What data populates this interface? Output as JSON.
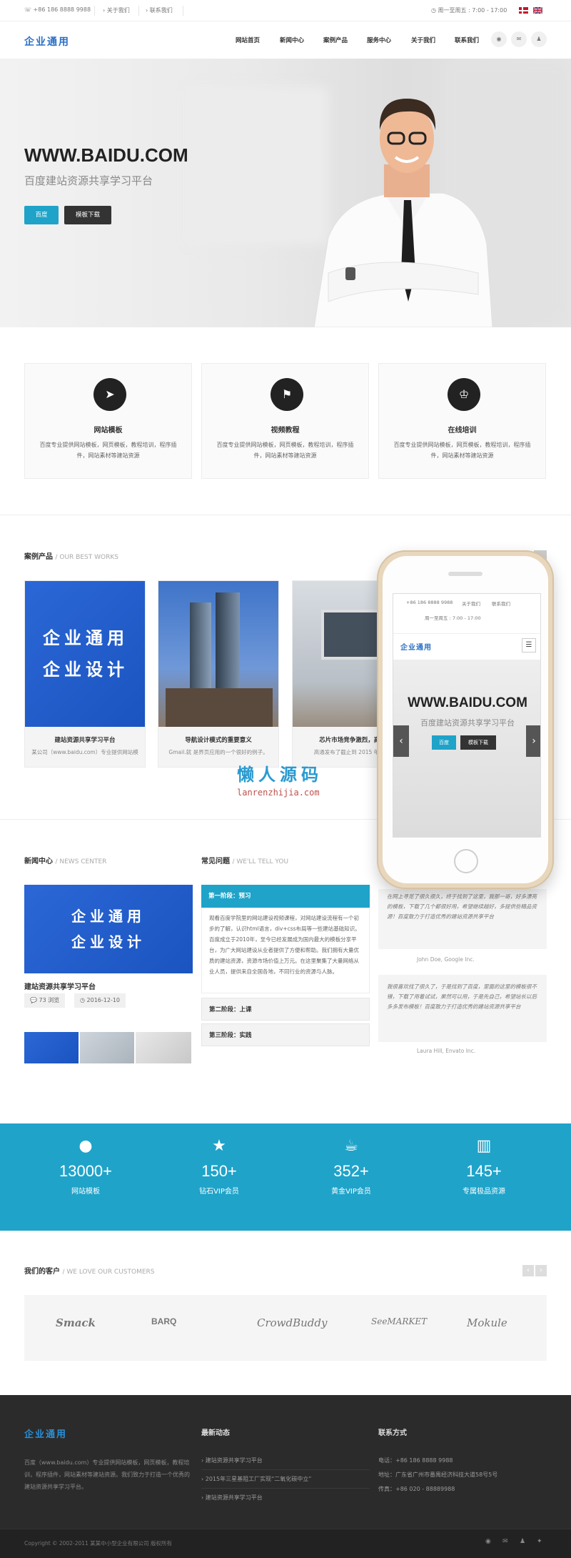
{
  "topbar": {
    "phone": "+86 186 8888 9988",
    "about": "关于我们",
    "contact": "联系我们",
    "hours": "周一至周五 : 7:00 - 17:00"
  },
  "header": {
    "logo": "企业通用",
    "nav": [
      "网站首页",
      "新闻中心",
      "案例产品",
      "服务中心",
      "关于我们",
      "联系我们"
    ]
  },
  "hero": {
    "title": "WWW.BAIDU.COM",
    "subtitle": "百度建站资源共享学习平台",
    "btn_primary": "百度",
    "btn_secondary": "模板下载"
  },
  "features": [
    {
      "title": "网站模板",
      "desc": "百度专业提供网站模板，网页模板，教程培训，程序插件，网站素材等建站资源"
    },
    {
      "title": "视频教程",
      "desc": "百度专业提供网站模板，网页模板，教程培训，程序插件，网站素材等建站资源"
    },
    {
      "title": "在线培训",
      "desc": "百度专业提供网站模板，网页模板，教程培训，程序插件，网站素材等建站资源"
    }
  ],
  "cases": {
    "heading": "案例产品",
    "heading_en": "/ OUR BEST WORKS",
    "items": [
      {
        "title": "建站资源共享学习平台",
        "desc": "某公司（www.baidu.com）专业提供网站模",
        "card_line1": "企业通用",
        "card_line2": "企业设计"
      },
      {
        "title": "导航设计模式的重要意义",
        "desc": "Gmail.就 是界页应用的一个很好的例子。"
      },
      {
        "title": "芯片市场竞争激烈，高通",
        "desc": "高通发布了截止到 2015 年 6 月"
      }
    ]
  },
  "phone_screen": {
    "phone": "+86 186 8888 9988",
    "about": "关于我们",
    "contact": "联系我们",
    "hours": "周一至周五 : 7:00 - 17:00",
    "logo": "企业通用",
    "title": "WWW.BAIDU.COM",
    "subtitle": "百度建站资源共享学习平台",
    "btn_primary": "百度",
    "btn_secondary": "模板下载"
  },
  "watermark": {
    "line1": "懒人源码",
    "line2": "lanrenzhijia.com"
  },
  "news": {
    "heading": "新闻中心",
    "heading_en": "/ NEWS CENTER",
    "card_line1": "企业通用",
    "card_line2": "企业设计",
    "title": "建站资源共享学习平台",
    "views": "73 浏览",
    "date": "2016-12-10"
  },
  "faq": {
    "heading": "常见问题",
    "heading_en": "/ WE'LL TELL YOU",
    "tabs": [
      "第一阶段：预习",
      "第二阶段：上课",
      "第三阶段：实践"
    ],
    "body": "观看百度学院里的网站建设视频课程，对网站建设流程有一个初步的了解，认识html语言，div+css布局等一些建站基础知识。百度成立于2010年，至今已经发展成为国内最大的模板分享平台，为广大网站建设从业者提供了方便和帮助。我们拥有大量优质的建站资源，资源市场价值上万元。在这里聚集了大量网络从业人员，提供来自全国各地，不同行业的资源与人脉。"
  },
  "testimonials": [
    {
      "text": "在网上寻觅了很久很久，终于找到了这里，我那一哥，好多漂亮的模板，下载了几个都很好用，希望继续越好，多提供些精品资源！百度致力于打造优秀的建站资源共享平台",
      "author": "John Doe, Google Inc."
    },
    {
      "text": "我很喜欢找了很久了，于是找到了百度，里面的这里的模板很不错，下载了用着试试，果然可以用，于是先自己，希望站长以后多多发布模板！百度致力于打造优秀的建站资源共享平台",
      "author": "Laura Hill, Envato Inc."
    }
  ],
  "stats": [
    {
      "value": "13000+",
      "label": "网站模板"
    },
    {
      "value": "150+",
      "label": "钻石VIP会员"
    },
    {
      "value": "352+",
      "label": "黄金VIP会员"
    },
    {
      "value": "145+",
      "label": "专属极品资源"
    }
  ],
  "clients": {
    "heading": "我们的客户",
    "heading_en": "/ WE LOVE OUR CUSTOMERS",
    "logos": [
      "Smack",
      "BARQ",
      "CrowdBuddy",
      "SeeMARKET",
      "Mokule"
    ]
  },
  "footer": {
    "logo": "企业通用",
    "about": "百度（www.baidu.com）专业提供网站模板，网页模板，教程培训，程序插件，网站素材等建站资源。我们致力于打造一个优秀的建站资源共享学习平台。",
    "news_heading": "最新动态",
    "news": [
      "建站资源共享学习平台",
      "2015年三星基阻工厂实现“二氧化碳中立”",
      "建站资源共享学习平台"
    ],
    "contact_heading": "联系方式",
    "phone": "电话：+86 186 8888 9988",
    "address": "地址：广东省广州市番禺经济科技大道58号5号",
    "fax": "传真：+86 020 - 88889988",
    "copyright": "Copyright © 2002-2011 某某中小型企业有限公司 版权所有"
  },
  "colors": {
    "accent": "#1fa3c9",
    "dark": "#2b2b2b",
    "logo": "#2a6fc4"
  }
}
